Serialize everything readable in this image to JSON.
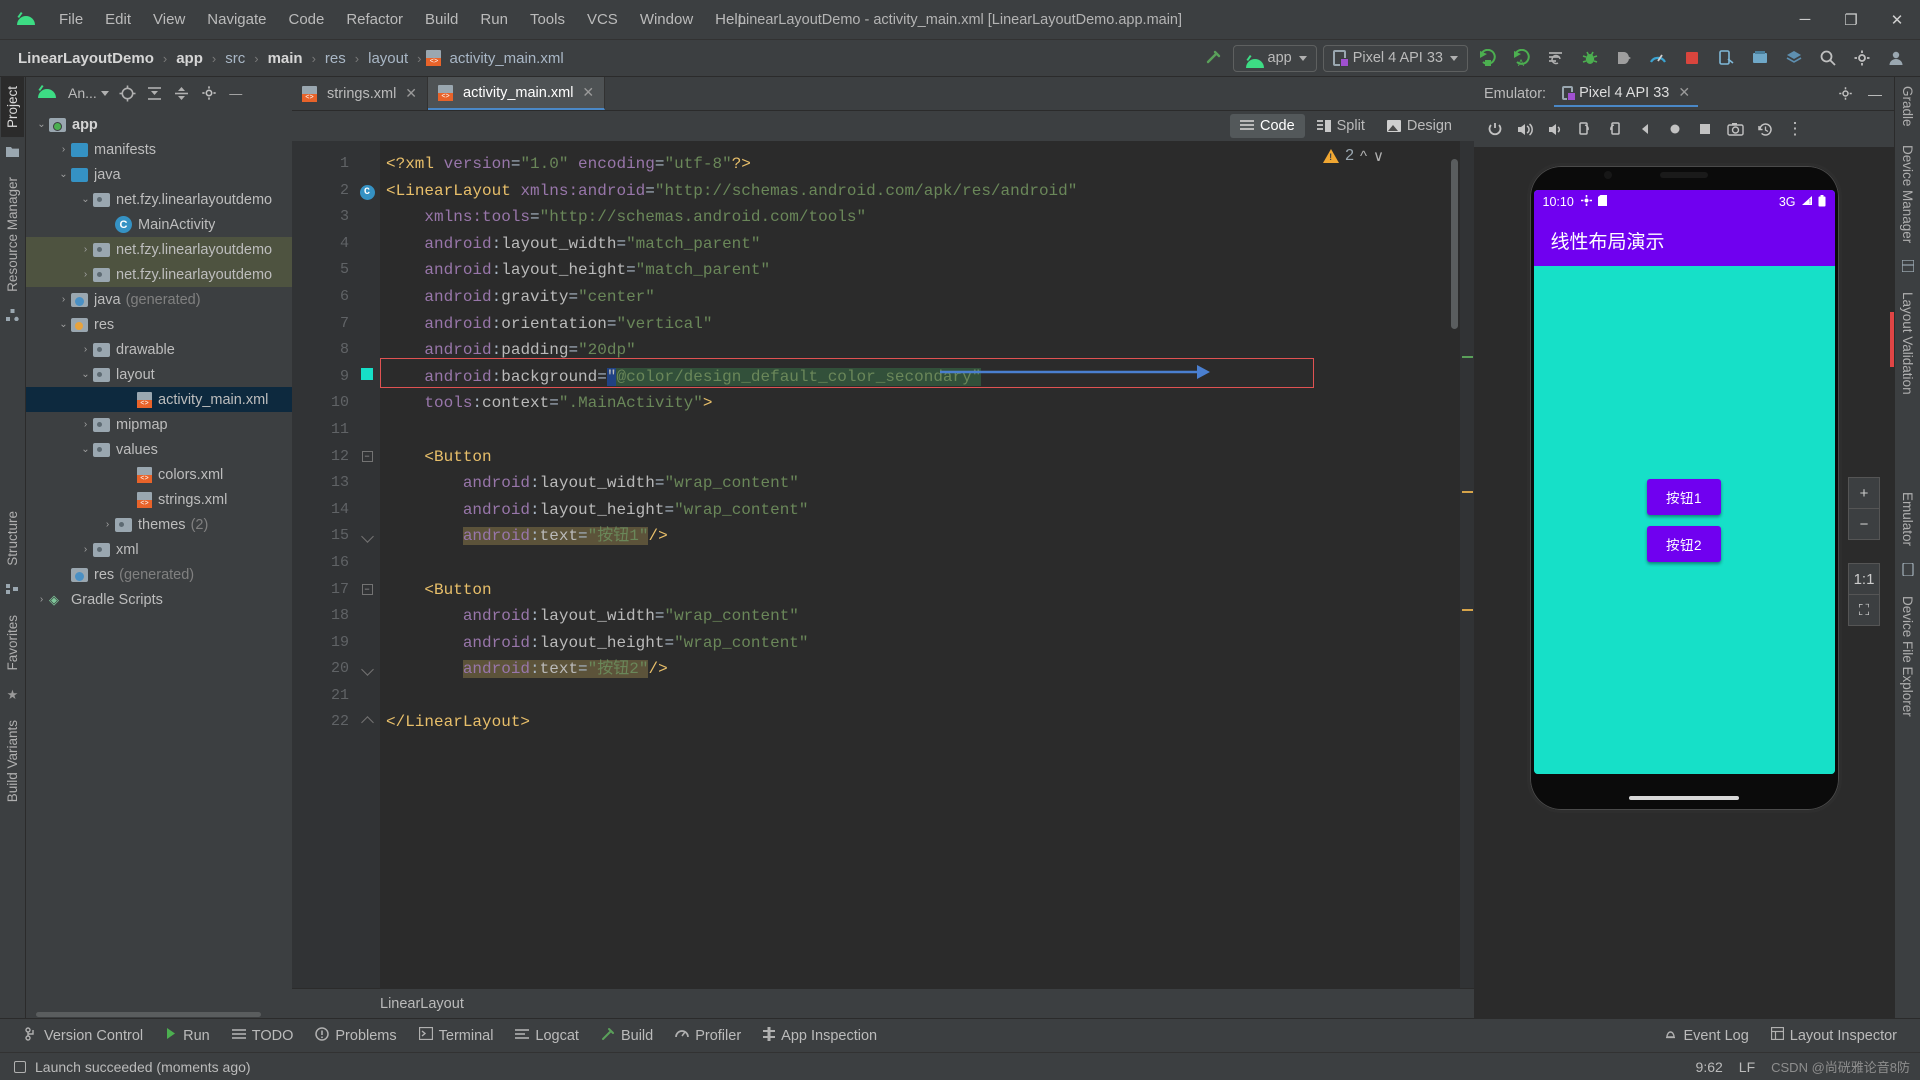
{
  "window": {
    "title": "LinearLayoutDemo - activity_main.xml [LinearLayoutDemo.app.main]",
    "minimize": "─",
    "maximize": "❐",
    "close": "✕"
  },
  "menu": [
    "File",
    "Edit",
    "View",
    "Navigate",
    "Code",
    "Refactor",
    "Build",
    "Run",
    "Tools",
    "VCS",
    "Window",
    "Help"
  ],
  "breadcrumb": {
    "items": [
      "LinearLayoutDemo",
      "app",
      "src",
      "main",
      "res",
      "layout",
      "activity_main.xml"
    ],
    "separator": "›"
  },
  "toolbar": {
    "run_config": "app",
    "device": "Pixel 4 API 33",
    "icons": [
      "hammer-build-icon",
      "run-icon",
      "debug-run-icon",
      "apply-changes-icon",
      "debug-icon",
      "attach-debugger-icon",
      "profiler-icon",
      "stop-icon",
      "device-manager-icon",
      "sdk-manager-icon",
      "avd-icon",
      "search-icon",
      "settings-icon",
      "account-icon"
    ]
  },
  "left_rail": {
    "tabs": [
      "Project",
      "Resource Manager",
      "Structure",
      "Favorites",
      "Build Variants"
    ]
  },
  "right_rail": {
    "tabs": [
      "Gradle",
      "Device Manager",
      "Layout Validation",
      "Emulator",
      "Device File Explorer"
    ]
  },
  "project_panel": {
    "selector": "An...",
    "header_icons": [
      "android-view-icon",
      "locate-icon",
      "expand-all-icon",
      "collapse-all-icon",
      "settings-icon",
      "hide-icon"
    ],
    "tree": [
      {
        "label": "app",
        "indent": 0,
        "arrow": "∨",
        "icon": "module-folder",
        "bold": true
      },
      {
        "label": "manifests",
        "indent": 1,
        "arrow": "›",
        "icon": "blue-folder"
      },
      {
        "label": "java",
        "indent": 1,
        "arrow": "∨",
        "icon": "blue-folder"
      },
      {
        "label": "net.fzy.linearlayoutdemo",
        "indent": 2,
        "arrow": "∨",
        "icon": "package"
      },
      {
        "label": "MainActivity",
        "indent": 3,
        "arrow": "",
        "icon": "class"
      },
      {
        "label": "net.fzy.linearlayoutdemo",
        "indent": 2,
        "arrow": "›",
        "icon": "package",
        "highlight": true
      },
      {
        "label": "net.fzy.linearlayoutdemo",
        "indent": 2,
        "arrow": "›",
        "icon": "package",
        "highlight": true
      },
      {
        "label": "java",
        "suffix": "(generated)",
        "indent": 1,
        "arrow": "›",
        "icon": "generated-folder"
      },
      {
        "label": "res",
        "indent": 1,
        "arrow": "∨",
        "icon": "res-folder"
      },
      {
        "label": "drawable",
        "indent": 2,
        "arrow": "›",
        "icon": "package"
      },
      {
        "label": "layout",
        "indent": 2,
        "arrow": "∨",
        "icon": "package"
      },
      {
        "label": "activity_main.xml",
        "indent": 4,
        "arrow": "",
        "icon": "xml-file",
        "selected": true
      },
      {
        "label": "mipmap",
        "indent": 2,
        "arrow": "›",
        "icon": "package"
      },
      {
        "label": "values",
        "indent": 2,
        "arrow": "∨",
        "icon": "package"
      },
      {
        "label": "colors.xml",
        "indent": 4,
        "arrow": "",
        "icon": "xml-file"
      },
      {
        "label": "strings.xml",
        "indent": 4,
        "arrow": "",
        "icon": "xml-file"
      },
      {
        "label": "themes",
        "suffix": "(2)",
        "indent": 3,
        "arrow": "›",
        "icon": "package"
      },
      {
        "label": "xml",
        "indent": 2,
        "arrow": "›",
        "icon": "package"
      },
      {
        "label": "res",
        "suffix": "(generated)",
        "indent": 1,
        "arrow": "",
        "icon": "generated-folder"
      },
      {
        "label": "Gradle Scripts",
        "indent": 0,
        "arrow": "›",
        "icon": "gradle"
      }
    ]
  },
  "editor": {
    "tabs": [
      {
        "label": "strings.xml",
        "active": false,
        "close": "✕"
      },
      {
        "label": "activity_main.xml",
        "active": true,
        "close": "✕"
      }
    ],
    "modes": [
      {
        "label": "Code",
        "selected": true
      },
      {
        "label": "Split",
        "selected": false
      },
      {
        "label": "Design",
        "selected": false
      }
    ],
    "warning_count": "2",
    "bottom_breadcrumb": "LinearLayout",
    "lines": [
      {
        "n": "1",
        "html": "<span class=\"brk\">&lt;?</span><span class=\"tagn\">xml </span><span class=\"ns\">version</span><span class=\"punc\">=</span><span class=\"str\">\"1.0\"</span><span class=\"ns\"> encoding</span><span class=\"punc\">=</span><span class=\"str\">\"utf-8\"</span><span class=\"brk\">?&gt;</span>"
      },
      {
        "n": "2",
        "html": "<span class=\"brk\">&lt;</span><span class=\"tagn\">LinearLayout</span> <span class=\"ns\">xmlns:android</span><span class=\"punc\">=</span><span class=\"str\">\"http://schemas.android.com/apk/res/android\"</span>"
      },
      {
        "n": "3",
        "html": "    <span class=\"ns\">xmlns:tools</span><span class=\"punc\">=</span><span class=\"str\">\"http://schemas.android.com/tools\"</span>"
      },
      {
        "n": "4",
        "html": "    <span class=\"ns\">android</span><span class=\"punc\">:</span><span class=\"attr\">layout_width</span><span class=\"punc\">=</span><span class=\"str\">\"match_parent\"</span>"
      },
      {
        "n": "5",
        "html": "    <span class=\"ns\">android</span><span class=\"punc\">:</span><span class=\"attr\">layout_height</span><span class=\"punc\">=</span><span class=\"str\">\"match_parent\"</span>"
      },
      {
        "n": "6",
        "html": "    <span class=\"ns\">android</span><span class=\"punc\">:</span><span class=\"attr\">gravity</span><span class=\"punc\">=</span><span class=\"str\">\"center\"</span>"
      },
      {
        "n": "7",
        "html": "    <span class=\"ns\">android</span><span class=\"punc\">:</span><span class=\"attr\">orientation</span><span class=\"punc\">=</span><span class=\"str\">\"vertical\"</span>"
      },
      {
        "n": "8",
        "html": "    <span class=\"ns\">android</span><span class=\"punc\">:</span><span class=\"attr\">padding</span><span class=\"punc\">=</span><span class=\"str\">\"20dp\"</span>"
      },
      {
        "n": "9",
        "html": "    <span class=\"ns\">android</span><span class=\"punc\">:</span><span class=\"attr\">background</span><span class=\"punc\">=</span><span class=\"selstr\">\"</span><span class=\"str greensel\">@color/design_default_color_secondary\"</span>"
      },
      {
        "n": "10",
        "html": "    <span class=\"ns\">tools</span><span class=\"punc\">:</span><span class=\"attr\">context</span><span class=\"punc\">=</span><span class=\"str\">\".MainActivity\"</span><span class=\"brk\">&gt;</span>"
      },
      {
        "n": "11",
        "html": ""
      },
      {
        "n": "12",
        "html": "    <span class=\"brk\">&lt;</span><span class=\"tagn\">Button</span>"
      },
      {
        "n": "13",
        "html": "        <span class=\"ns\">android</span><span class=\"punc\">:</span><span class=\"attr\">layout_width</span><span class=\"punc\">=</span><span class=\"str\">\"wrap_content\"</span>"
      },
      {
        "n": "14",
        "html": "        <span class=\"ns\">android</span><span class=\"punc\">:</span><span class=\"attr\">layout_height</span><span class=\"punc\">=</span><span class=\"str\">\"wrap_content\"</span>"
      },
      {
        "n": "15",
        "html": "        <span class=\"brownsel\"><span class=\"ns\">android</span><span class=\"punc\">:</span><span class=\"attr\">text</span><span class=\"punc\">=</span><span class=\"str\">\"按钮1\"</span></span><span class=\"brk\">/&gt;</span>"
      },
      {
        "n": "16",
        "html": ""
      },
      {
        "n": "17",
        "html": "    <span class=\"brk\">&lt;</span><span class=\"tagn\">Button</span>"
      },
      {
        "n": "18",
        "html": "        <span class=\"ns\">android</span><span class=\"punc\">:</span><span class=\"attr\">layout_width</span><span class=\"punc\">=</span><span class=\"str\">\"wrap_content\"</span>"
      },
      {
        "n": "19",
        "html": "        <span class=\"ns\">android</span><span class=\"punc\">:</span><span class=\"attr\">layout_height</span><span class=\"punc\">=</span><span class=\"str\">\"wrap_content\"</span>"
      },
      {
        "n": "20",
        "html": "        <span class=\"brownsel\"><span class=\"ns\">android</span><span class=\"punc\">:</span><span class=\"attr\">text</span><span class=\"punc\">=</span><span class=\"str\">\"按钮2\"</span></span><span class=\"brk\">/&gt;</span>"
      },
      {
        "n": "21",
        "html": ""
      },
      {
        "n": "22",
        "html": "<span class=\"brk\">&lt;/</span><span class=\"tagn\">LinearLayout</span><span class=\"brk\">&gt;</span>"
      }
    ]
  },
  "emulator": {
    "panel_label": "Emulator:",
    "tab_label": "Pixel 4 API 33",
    "tab_close": "✕",
    "toolbar_icons": [
      "power-icon",
      "volume-up-icon",
      "volume-down-icon",
      "rotate-left-icon",
      "rotate-right-icon",
      "back-icon",
      "home-icon",
      "overview-icon",
      "screenshot-icon",
      "history-icon",
      "more-icon"
    ],
    "zoom_controls": [
      "+",
      "−",
      "1:1",
      "⛶"
    ],
    "device": {
      "status_time": "10:10",
      "status_left_icons": [
        "settings-gear-icon",
        "sdcard-icon"
      ],
      "status_network": "3G",
      "status_right_icons": [
        "signal-icon",
        "battery-icon"
      ],
      "app_title": "线性布局演示",
      "buttons": [
        "按钮1",
        "按钮2"
      ],
      "bar_color": "#7000f0",
      "bg_color": "#16e0c8"
    }
  },
  "bottom_bar": {
    "left": [
      {
        "label": "Version Control",
        "icon": "branch-icon"
      },
      {
        "label": "Run",
        "icon": "play-icon"
      },
      {
        "label": "TODO",
        "icon": "list-icon"
      },
      {
        "label": "Problems",
        "icon": "warning-circle-icon"
      },
      {
        "label": "Terminal",
        "icon": "terminal-icon"
      },
      {
        "label": "Logcat",
        "icon": "logcat-icon"
      },
      {
        "label": "Build",
        "icon": "hammer-icon"
      },
      {
        "label": "Profiler",
        "icon": "gauge-icon"
      },
      {
        "label": "App Inspection",
        "icon": "inspect-icon"
      }
    ],
    "right": [
      {
        "label": "Event Log",
        "icon": "bell-icon"
      },
      {
        "label": "Layout Inspector",
        "icon": "layout-icon"
      }
    ]
  },
  "status_line": {
    "message": "Launch succeeded (moments ago)",
    "caret": "9:62",
    "line_sep": "LF",
    "watermark": "CSDN @尚硄雅论音8防"
  }
}
